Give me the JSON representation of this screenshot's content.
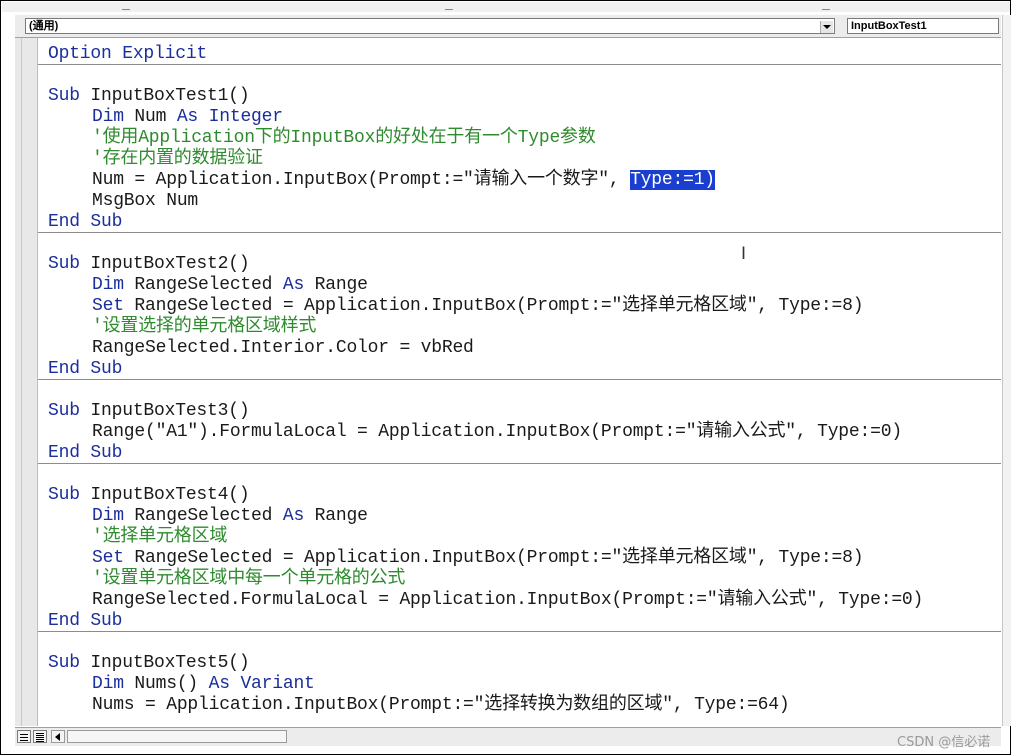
{
  "toolbar": {
    "object_combo": "(通用)",
    "procedure_combo": "InputBoxTest1"
  },
  "code": {
    "line01": "Option Explicit",
    "line02_kw": "Sub",
    "line02_name": " InputBoxTest1()",
    "line03_kw1": "Dim",
    "line03_mid": " Num ",
    "line03_kw2": "As Integer",
    "line04": "'使用Application下的InputBox的好处在于有一个Type参数",
    "line05": "'存在内置的数据验证",
    "line06_pre": "Num = Application.InputBox(Prompt:=\"请输入一个数字\", ",
    "line06_sel": "Type:=1)",
    "line07": "MsgBox Num",
    "line08": "End Sub",
    "line09_kw": "Sub",
    "line09_name": " InputBoxTest2()",
    "line10_kw1": "Dim",
    "line10_mid": " RangeSelected ",
    "line10_kw2": "As",
    "line10_post": " Range",
    "line11_kw": "Set",
    "line11_rest": " RangeSelected = Application.InputBox(Prompt:=\"选择单元格区域\", Type:=8)",
    "line12": "'设置选择的单元格区域样式",
    "line13": "RangeSelected.Interior.Color = vbRed",
    "line14": "End Sub",
    "line15_kw": "Sub",
    "line15_name": " InputBoxTest3()",
    "line16": "Range(\"A1\").FormulaLocal = Application.InputBox(Prompt:=\"请输入公式\", Type:=0)",
    "line17": "End Sub",
    "line18_kw": "Sub",
    "line18_name": " InputBoxTest4()",
    "line19_kw1": "Dim",
    "line19_mid": " RangeSelected ",
    "line19_kw2": "As",
    "line19_post": " Range",
    "line20": "'选择单元格区域",
    "line21_kw": "Set",
    "line21_rest": " RangeSelected = Application.InputBox(Prompt:=\"选择单元格区域\", Type:=8)",
    "line22": "'设置单元格区域中每一个单元格的公式",
    "line23": "RangeSelected.FormulaLocal = Application.InputBox(Prompt:=\"请输入公式\", Type:=0)",
    "line24": "End Sub",
    "line25_kw": "Sub",
    "line25_name": " InputBoxTest5()",
    "line26_kw1": "Dim",
    "line26_mid": " Nums() ",
    "line26_kw2": "As Variant",
    "line27": "Nums = Application.InputBox(Prompt:=\"选择转换为数组的区域\", Type:=64)"
  },
  "colors": {
    "keyword": "#1a2e9c",
    "comment": "#2e8b2e",
    "selection": "#1a3fd0"
  },
  "icons": {
    "procedure_view": "procedure-view-icon",
    "full_module_view": "full-module-view-icon",
    "scroll_left": "scroll-left-arrow-icon",
    "text_cursor": "i-beam-cursor-icon"
  },
  "watermark": "CSDN @信必诺"
}
